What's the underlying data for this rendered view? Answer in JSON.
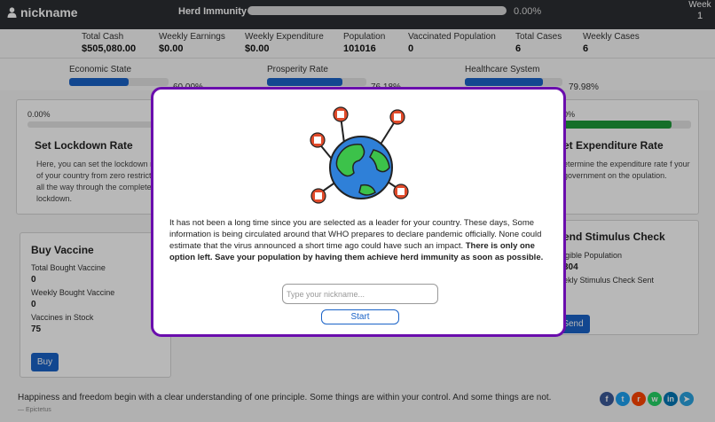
{
  "app": {
    "nickname": "nickname"
  },
  "herd": {
    "label": "Herd Immunity",
    "value": 0,
    "percent": "0.00%"
  },
  "week": {
    "label": "Week",
    "value": "1"
  },
  "stats": [
    {
      "label": "Total Cash",
      "value": "$505,080.00"
    },
    {
      "label": "Weekly Earnings",
      "value": "$0.00"
    },
    {
      "label": "Weekly Expenditure",
      "value": "$0.00"
    },
    {
      "label": "Population",
      "value": "101016"
    },
    {
      "label": "Vaccinated Population",
      "value": "0"
    },
    {
      "label": "Total Cases",
      "value": "6"
    },
    {
      "label": "Weekly Cases",
      "value": "6"
    }
  ],
  "meters": [
    {
      "label": "Economic State",
      "percent": "60.00%",
      "value": 0.6
    },
    {
      "label": "Prosperity Rate",
      "percent": "76.18%",
      "value": 0.7618
    },
    {
      "label": "Healthcare System",
      "percent": "79.98%",
      "value": 0.7998
    }
  ],
  "lockdown": {
    "percent": "0.00%",
    "title": "Set Lockdown Rate",
    "desc": "Here, you can set the lockdown rate of your country from zero restrictions all the way through the complete lockdown."
  },
  "expenditure": {
    "percent": "0%",
    "value": 0.85,
    "title": "et Expenditure Rate",
    "desc": "etermine the expenditure rate f your government on the opulation."
  },
  "vaccine": {
    "title": "Buy Vaccine",
    "total_label": "Total Bought Vaccine",
    "total_value": "0",
    "weekly_label": "Weekly Bought Vaccine",
    "weekly_value": "0",
    "stock_label": "Vaccines in Stock",
    "stock_value": "75",
    "button": "Buy"
  },
  "stimulus": {
    "title": "end Stimulus Check",
    "eligible_label": "igible Population",
    "eligible_value": "304",
    "weekly_label": "ekly Stimulus Check Sent",
    "button": "Send"
  },
  "footer": {
    "quote": "Happiness and freedom begin with a clear understanding of one principle. Some things are within your control. And some things are not.",
    "author": "— Epictetus"
  },
  "socials": [
    {
      "icon": "facebook-icon",
      "glyph": "f",
      "color": "#3b5998"
    },
    {
      "icon": "twitter-icon",
      "glyph": "t",
      "color": "#1da1f2"
    },
    {
      "icon": "reddit-icon",
      "glyph": "r",
      "color": "#ff4500"
    },
    {
      "icon": "whatsapp-icon",
      "glyph": "w",
      "color": "#25d366"
    },
    {
      "icon": "linkedin-icon",
      "glyph": "in",
      "color": "#0077b5"
    },
    {
      "icon": "telegram-icon",
      "glyph": "➤",
      "color": "#2aa3df"
    }
  ],
  "modal": {
    "story": "It has not been a long time since you are selected as a leader for your country. These days, Some information is being circulated around that WHO prepares to declare pandemic officially. None could estimate that the virus announced a short time ago could have such an impact.",
    "story_bold": "There is only one option left. Save your population by having them achieve herd immunity as soon as possible.",
    "placeholder": "Type your nickname...",
    "start": "Start"
  }
}
